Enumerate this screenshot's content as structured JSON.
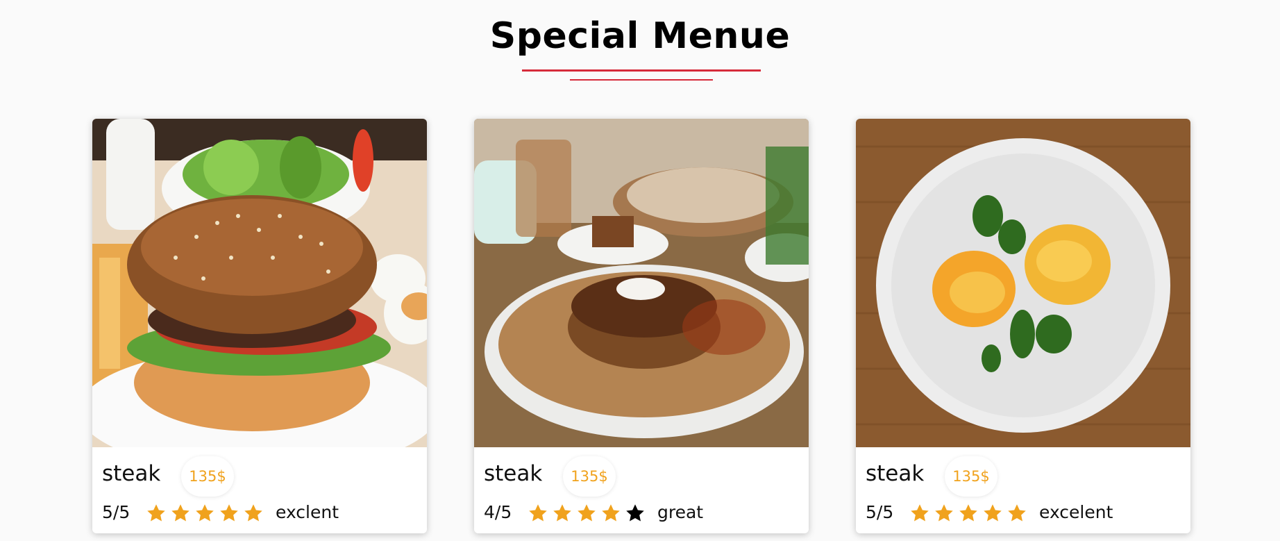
{
  "page": {
    "title": "Special Menue"
  },
  "colors": {
    "accent_red": "#d62b3a",
    "price_orange": "#f0a21d",
    "star_gold": "#f0a21d",
    "star_empty": "#000000"
  },
  "menu": [
    {
      "name": "steak",
      "price": "135$",
      "score": "5/5",
      "rating": 5,
      "max_rating": 5,
      "verdict": "exclent",
      "image": "burger-photo"
    },
    {
      "name": "steak",
      "price": "135$",
      "score": "4/5",
      "rating": 4,
      "max_rating": 5,
      "verdict": "great",
      "image": "pancakes-photo"
    },
    {
      "name": "steak",
      "price": "135$",
      "score": "5/5",
      "rating": 5,
      "max_rating": 5,
      "verdict": "excelent",
      "image": "eggs-benedict-photo"
    }
  ]
}
